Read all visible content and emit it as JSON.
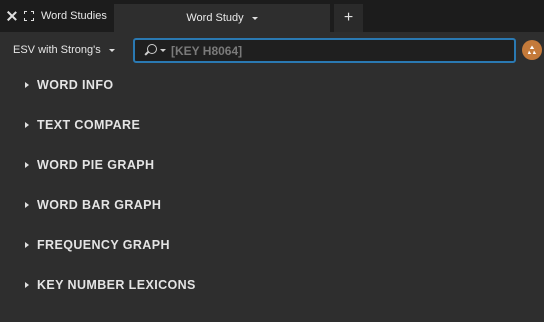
{
  "tabbar": {
    "panel_title": "Word Studies",
    "doc_tab_label": "Word Study",
    "add_tab_label": "+"
  },
  "toolbar": {
    "resource": "ESV with Strong's",
    "search_placeholder": "[KEY H8064]"
  },
  "sections": [
    {
      "label": "WORD INFO"
    },
    {
      "label": "TEXT COMPARE"
    },
    {
      "label": "WORD PIE GRAPH"
    },
    {
      "label": "WORD BAR GRAPH"
    },
    {
      "label": "FREQUENCY GRAPH"
    },
    {
      "label": "KEY NUMBER LEXICONS"
    }
  ],
  "colors": {
    "accent_border": "#2a79b2",
    "go_button": "#c47a3a",
    "background": "#2e2e2e",
    "tabbar": "#1c1c1c"
  },
  "icons": [
    "close-icon",
    "expand-icon",
    "chevron-down-icon",
    "search-icon",
    "recycle-icon",
    "chevron-right-icon"
  ]
}
